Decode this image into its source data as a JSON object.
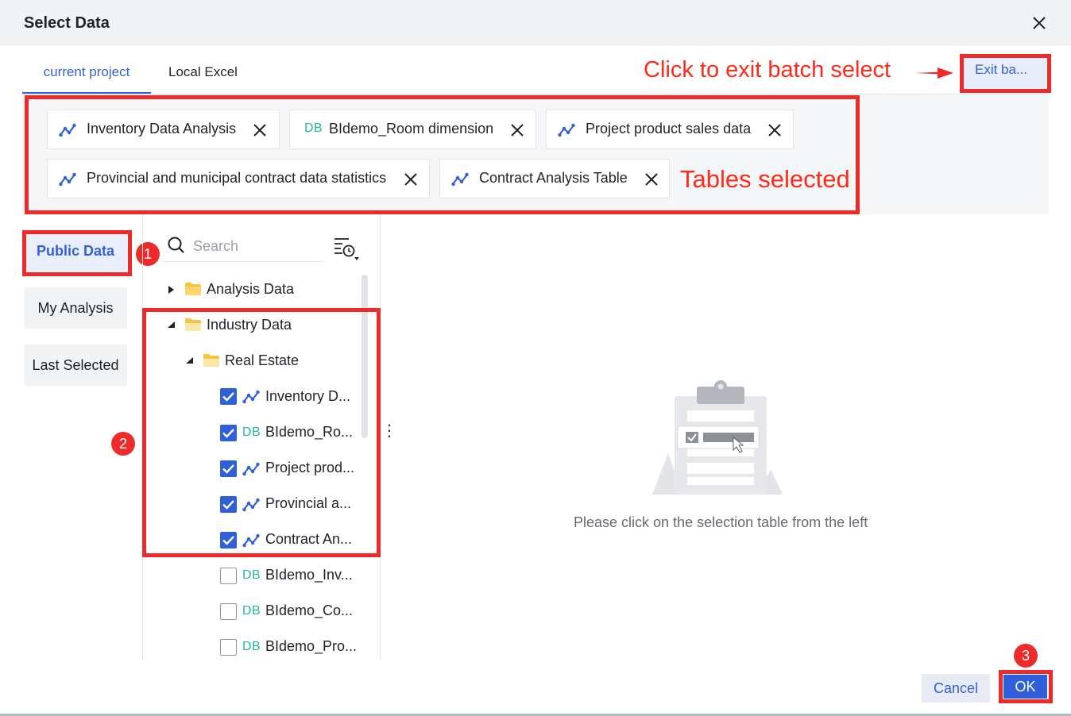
{
  "dialog": {
    "title": "Select Data",
    "close_icon": "close-icon"
  },
  "tabs": [
    {
      "label": "current project",
      "active": true
    },
    {
      "label": "Local Excel",
      "active": false
    }
  ],
  "exit_button": {
    "label": "Exit ba..."
  },
  "annotations": {
    "exit_hint": "Click to exit batch select",
    "tables_hint": "Tables selected",
    "steps": [
      "1",
      "2",
      "3"
    ],
    "color": "#ee2b2b"
  },
  "selected_tables": [
    {
      "label": "Inventory Data Analysis",
      "icon": "analysis-line-icon"
    },
    {
      "label": "BIdemo_Room dimension",
      "icon": "DB"
    },
    {
      "label": "Project product sales data",
      "icon": "analysis-line-icon"
    },
    {
      "label": "Provincial and municipal contract data statistics",
      "icon": "analysis-line-icon"
    },
    {
      "label": "Contract Analysis Table",
      "icon": "analysis-line-icon"
    }
  ],
  "categories": [
    {
      "label": "Public Data",
      "active": true
    },
    {
      "label": "My Analysis",
      "active": false
    },
    {
      "label": "Last Selected",
      "active": false
    }
  ],
  "search": {
    "placeholder": "Search",
    "value": ""
  },
  "tree": {
    "folders": [
      {
        "label": "Analysis Data",
        "expanded": false
      },
      {
        "label": "Industry Data",
        "expanded": true
      },
      {
        "label": "Real Estate",
        "expanded": true
      }
    ],
    "items": [
      {
        "label": "Inventory D...",
        "icon": "analysis-line-icon",
        "checked": true
      },
      {
        "label": "BIdemo_Ro...",
        "icon": "DB",
        "checked": true
      },
      {
        "label": "Project prod...",
        "icon": "analysis-line-icon",
        "checked": true
      },
      {
        "label": "Provincial a...",
        "icon": "analysis-line-icon",
        "checked": true
      },
      {
        "label": "Contract An...",
        "icon": "analysis-line-icon",
        "checked": true
      },
      {
        "label": "BIdemo_Inv...",
        "icon": "DB",
        "checked": false
      },
      {
        "label": "BIdemo_Co...",
        "icon": "DB",
        "checked": false
      },
      {
        "label": "BIdemo_Pro...",
        "icon": "DB",
        "checked": false
      }
    ]
  },
  "empty_state": {
    "text": "Please click on the selection table from the left"
  },
  "footer": {
    "cancel_label": "Cancel",
    "ok_label": "OK"
  },
  "colors": {
    "accent": "#3360d6",
    "db_icon": "#27b5a6",
    "folder": "#f6c343"
  }
}
